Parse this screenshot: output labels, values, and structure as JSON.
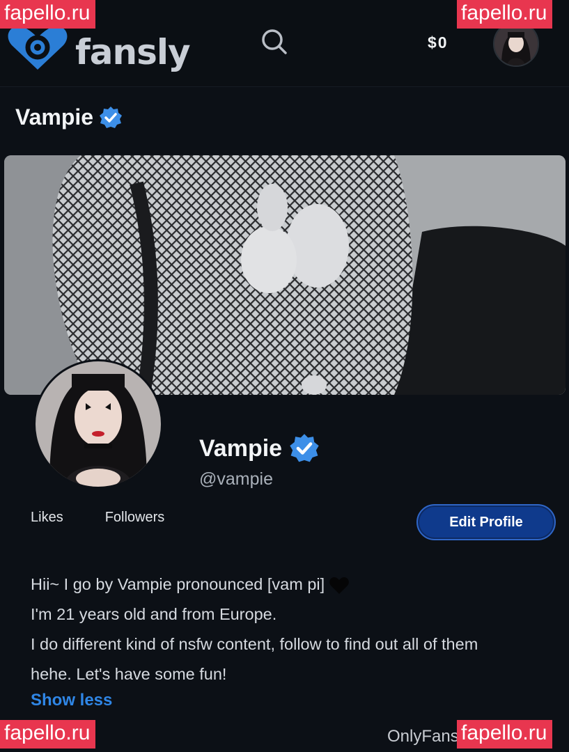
{
  "header": {
    "logo_text": "fansly",
    "balance": "$0"
  },
  "watermarks": {
    "top_left": "fapello.ru",
    "top_right": "fapello.ru",
    "bottom_left": "fapello.ru",
    "bottom_right": "fapello.ru"
  },
  "profile": {
    "page_title": "Vampie",
    "display_name": "Vampie",
    "handle": "@vampie",
    "stats": {
      "likes_label": "Likes",
      "followers_label": "Followers"
    },
    "edit_label": "Edit Profile",
    "bio": [
      "Hii~ I go by Vampie pronounced [vam pi]",
      "I'm 21 years old and from Europe.",
      "I do different kind of nsfw content, follow to find out all of them",
      "hehe. Let's have some fun!"
    ],
    "show_less_label": "Show less"
  },
  "footer": {
    "text": "OnlyFans"
  },
  "colors": {
    "background": "#0c1016",
    "accent_blue": "#2f86e6",
    "button_blue": "#0f3a8c",
    "verified_blue": "#3d8fe8",
    "watermark_red": "#e8364f"
  },
  "icons": [
    "fansly-logo-icon",
    "search-icon",
    "verified-badge-icon",
    "black-heart-icon"
  ]
}
